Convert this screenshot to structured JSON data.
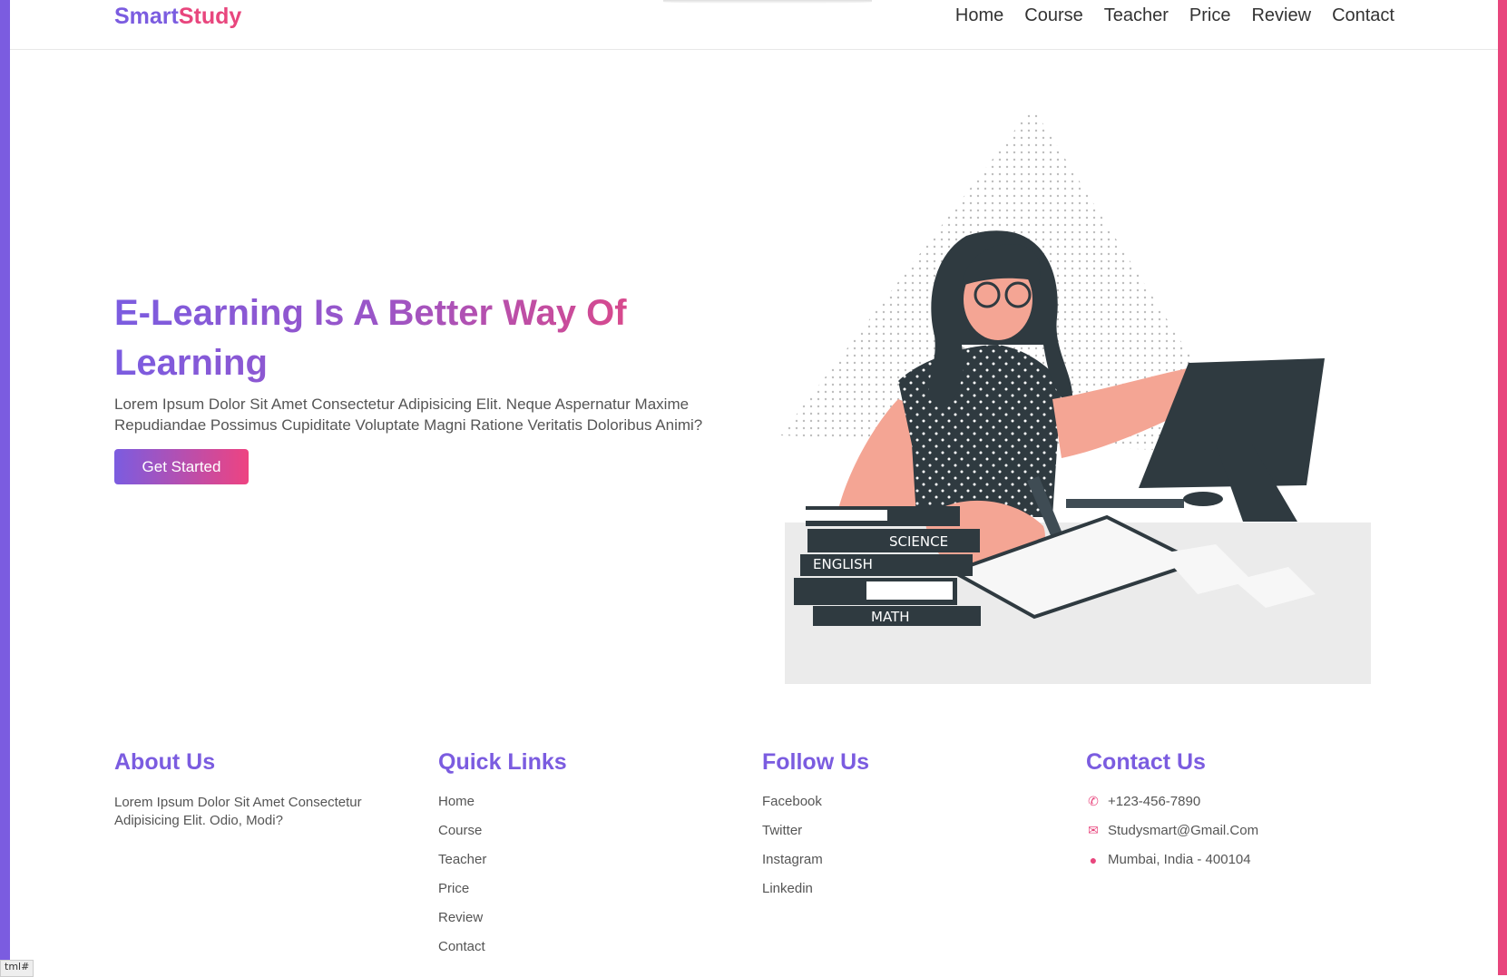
{
  "brand": {
    "part1": "Smart",
    "part2": "Study"
  },
  "nav": [
    "Home",
    "Course",
    "Teacher",
    "Price",
    "Review",
    "Contact"
  ],
  "hero": {
    "title": "E-Learning Is A Better Way Of Learning",
    "text": "Lorem Ipsum Dolor Sit Amet Consectetur Adipisicing Elit. Neque Aspernatur Maxime Repudiandae Possimus Cupiditate Voluptate Magni Ratione Veritatis Doloribus Animi?",
    "cta": "Get Started"
  },
  "illustration": {
    "books": [
      "SCIENCE",
      "ENGLISH",
      "MATH"
    ]
  },
  "footer": {
    "about": {
      "title": "About Us",
      "text": "Lorem Ipsum Dolor Sit Amet Consectetur Adipisicing Elit. Odio, Modi?"
    },
    "quick": {
      "title": "Quick Links",
      "links": [
        "Home",
        "Course",
        "Teacher",
        "Price",
        "Review",
        "Contact"
      ]
    },
    "follow": {
      "title": "Follow Us",
      "links": [
        "Facebook",
        "Twitter",
        "Instagram",
        "Linkedin"
      ]
    },
    "contact": {
      "title": "Contact Us",
      "phone": "+123-456-7890",
      "email": "Studysmart@Gmail.Com",
      "address": "Mumbai, India - 400104"
    }
  },
  "statusbar": "tml#",
  "colors": {
    "primary": "#7b5ce0",
    "accent": "#e8467d"
  }
}
